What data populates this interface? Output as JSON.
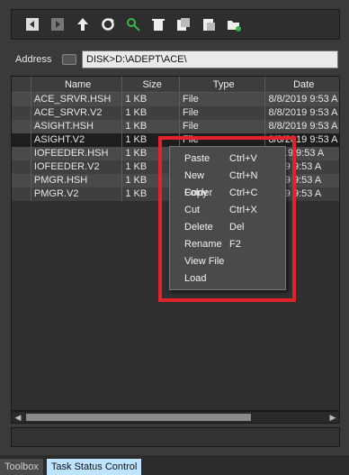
{
  "toolbar": {
    "buttons": [
      {
        "icon": "back-icon"
      },
      {
        "icon": "forward-icon"
      },
      {
        "icon": "up-arrow-icon"
      },
      {
        "icon": "refresh-icon"
      },
      {
        "icon": "find-icon"
      },
      {
        "icon": "delete-icon"
      },
      {
        "icon": "copy-icon"
      },
      {
        "icon": "paste-icon"
      },
      {
        "icon": "new-folder-icon"
      }
    ]
  },
  "address": {
    "label": "Address",
    "value": "DISK>D:\\ADEPT\\ACE\\"
  },
  "grid": {
    "headers": [
      "",
      "Name",
      "Size",
      "Type",
      "Date"
    ],
    "rows": [
      {
        "name": "ACE_SRVR.HSH",
        "size": "1 KB",
        "type": "File",
        "date": "8/8/2019 9:53 A"
      },
      {
        "name": "ACE_SRVR.V2",
        "size": "1 KB",
        "type": "File",
        "date": "8/8/2019 9:53 A"
      },
      {
        "name": "ASIGHT.HSH",
        "size": "1 KB",
        "type": "File",
        "date": "8/8/2019 9:53 A"
      },
      {
        "name": "ASIGHT.V2",
        "size": "1 KB",
        "type": "File",
        "date": "8/8/2019 9:53 A"
      },
      {
        "name": "IOFEEDER.HSH",
        "size": "1 KB",
        "type": "",
        "date": "/2019 9:53 A"
      },
      {
        "name": "IOFEEDER.V2",
        "size": "1 KB",
        "type": "",
        "date": "2019 9:53 A"
      },
      {
        "name": "PMGR.HSH",
        "size": "1 KB",
        "type": "",
        "date": "2019 9:53 A"
      },
      {
        "name": "PMGR.V2",
        "size": "1 KB",
        "type": "",
        "date": "2019 9:53 A"
      }
    ]
  },
  "context_menu": {
    "items": [
      {
        "label": "Paste",
        "shortcut": "Ctrl+V"
      },
      {
        "label": "New Folder",
        "shortcut": "Ctrl+N"
      },
      {
        "label": "Copy",
        "shortcut": "Ctrl+C"
      },
      {
        "label": "Cut",
        "shortcut": "Ctrl+X"
      },
      {
        "label": "Delete",
        "shortcut": "Del"
      },
      {
        "label": "Rename",
        "shortcut": "F2"
      },
      {
        "label": "View File",
        "shortcut": ""
      },
      {
        "label": "Load",
        "shortcut": ""
      }
    ]
  },
  "bottom_tabs": {
    "toolbox": "Toolbox",
    "task_status": "Task Status Control"
  },
  "colors": {
    "highlight": "#e3232b",
    "active_tab": "#bfe4ff"
  }
}
